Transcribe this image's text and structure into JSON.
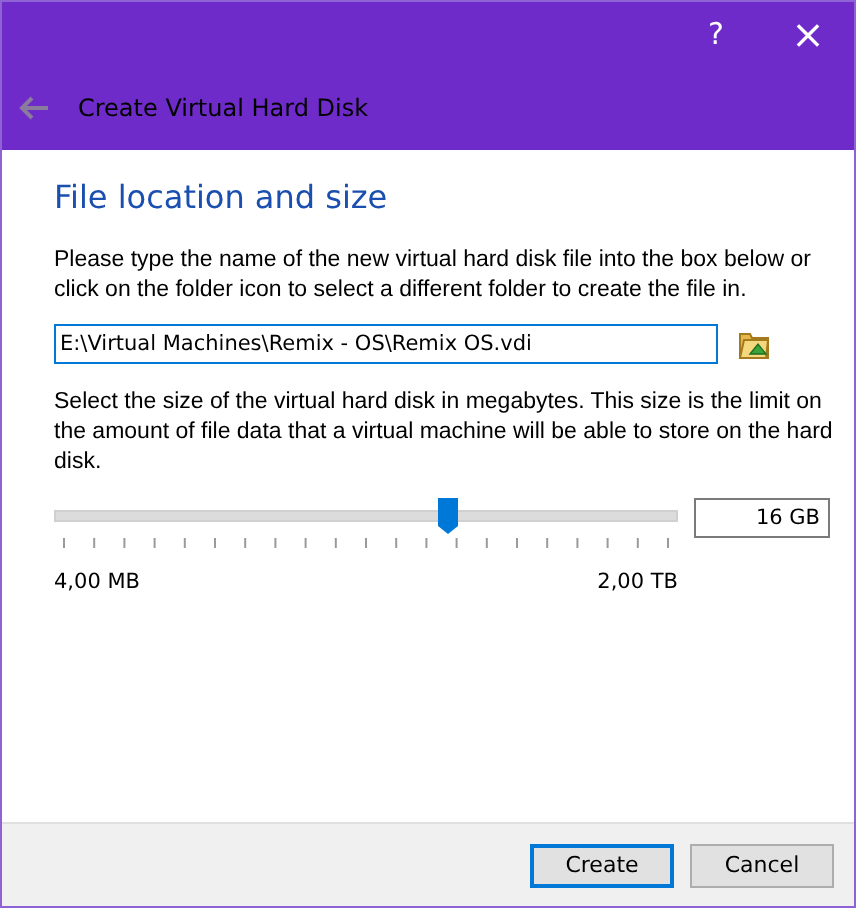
{
  "window": {
    "help_button": "?",
    "close_button": "×",
    "back_enabled": false,
    "title": "Create Virtual Hard Disk"
  },
  "page": {
    "heading": "File location and size",
    "location_text": "Please type the name of the new virtual hard disk file into the box below or click on the folder icon to select a different folder to create the file in.",
    "location_value": "E:\\Virtual Machines\\Remix - OS\\Remix OS.vdi",
    "size_text": "Select the size of the virtual hard disk in megabytes. This size is the limit on the amount of file data that a virtual machine will be able to store on the hard disk.",
    "size_slider": {
      "level": 0.63,
      "min_label": "4,00 MB",
      "max_label": "2,00 TB"
    },
    "size_value": "16 GB"
  },
  "buttons": [
    {
      "label": "Create",
      "selected": true
    },
    {
      "label": "Cancel",
      "selected": false
    }
  ]
}
